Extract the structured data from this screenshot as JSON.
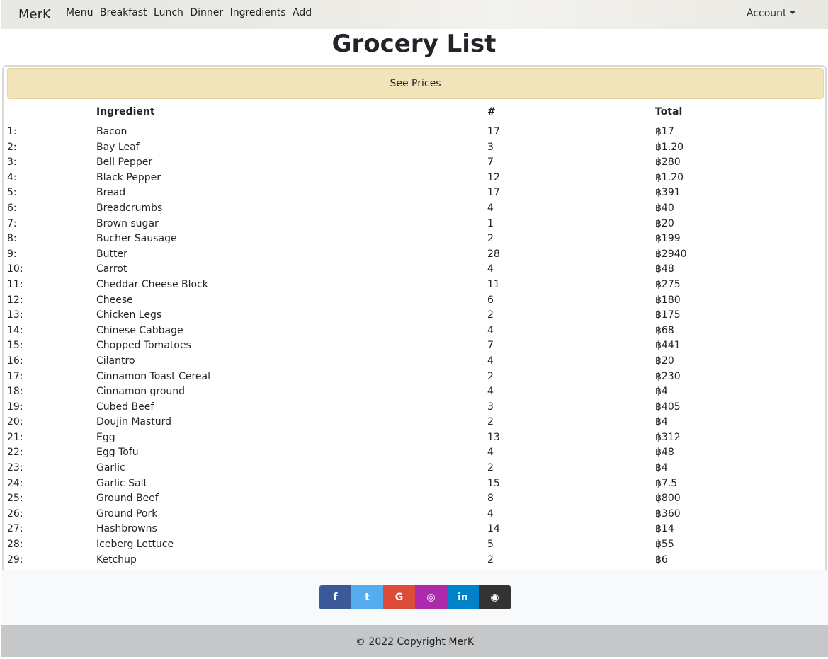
{
  "nav": {
    "brand": "MerK",
    "links": [
      "Menu",
      "Breakfast",
      "Lunch",
      "Dinner",
      "Ingredients",
      "Add"
    ],
    "account": "Account"
  },
  "page": {
    "title": "Grocery List",
    "see_prices": "See Prices"
  },
  "table": {
    "headers": [
      "",
      "Ingredient",
      "#",
      "Total"
    ],
    "rows": [
      [
        "1:",
        "Bacon",
        "17",
        "฿17"
      ],
      [
        "2:",
        "Bay Leaf",
        "3",
        "฿1.20"
      ],
      [
        "3:",
        "Bell Pepper",
        "7",
        "฿280"
      ],
      [
        "4:",
        "Black Pepper",
        "12",
        "฿1.20"
      ],
      [
        "5:",
        "Bread",
        "17",
        "฿391"
      ],
      [
        "6:",
        "Breadcrumbs",
        "4",
        "฿40"
      ],
      [
        "7:",
        "Brown sugar",
        "1",
        "฿20"
      ],
      [
        "8:",
        "Bucher Sausage",
        "2",
        "฿199"
      ],
      [
        "9:",
        "Butter",
        "28",
        "฿2940"
      ],
      [
        "10:",
        "Carrot",
        "4",
        "฿48"
      ],
      [
        "11:",
        "Cheddar Cheese Block",
        "11",
        "฿275"
      ],
      [
        "12:",
        "Cheese",
        "6",
        "฿180"
      ],
      [
        "13:",
        "Chicken Legs",
        "2",
        "฿175"
      ],
      [
        "14:",
        "Chinese Cabbage",
        "4",
        "฿68"
      ],
      [
        "15:",
        "Chopped Tomatoes",
        "7",
        "฿441"
      ],
      [
        "16:",
        "Cilantro",
        "4",
        "฿20"
      ],
      [
        "17:",
        "Cinnamon Toast Cereal",
        "2",
        "฿230"
      ],
      [
        "18:",
        "Cinnamon ground",
        "4",
        "฿4"
      ],
      [
        "19:",
        "Cubed Beef",
        "3",
        "฿405"
      ],
      [
        "20:",
        "Doujin Masturd",
        "2",
        "฿4"
      ],
      [
        "21:",
        "Egg",
        "13",
        "฿312"
      ],
      [
        "22:",
        "Egg Tofu",
        "4",
        "฿48"
      ],
      [
        "23:",
        "Garlic",
        "2",
        "฿4"
      ],
      [
        "24:",
        "Garlic Salt",
        "15",
        "฿7.5"
      ],
      [
        "25:",
        "Ground Beef",
        "8",
        "฿800"
      ],
      [
        "26:",
        "Ground Pork",
        "4",
        "฿360"
      ],
      [
        "27:",
        "Hashbrowns",
        "14",
        "฿14"
      ],
      [
        "28:",
        "Iceberg Lettuce",
        "5",
        "฿55"
      ],
      [
        "29:",
        "Ketchup",
        "2",
        "฿6"
      ]
    ]
  },
  "social": [
    {
      "icon": "facebook-icon",
      "glyph": "f",
      "color": "#3b5998"
    },
    {
      "icon": "twitter-icon",
      "glyph": "t",
      "color": "#55acee"
    },
    {
      "icon": "google-icon",
      "glyph": "G",
      "color": "#dd4b39"
    },
    {
      "icon": "instagram-icon",
      "glyph": "◎",
      "color": "#ac2bac"
    },
    {
      "icon": "linkedin-icon",
      "glyph": "in",
      "color": "#0082ca"
    },
    {
      "icon": "github-icon",
      "glyph": "◉",
      "color": "#333333"
    }
  ],
  "footer": {
    "copyright_prefix": "© 2022 Copyright ",
    "copyright_brand": "MerK"
  }
}
